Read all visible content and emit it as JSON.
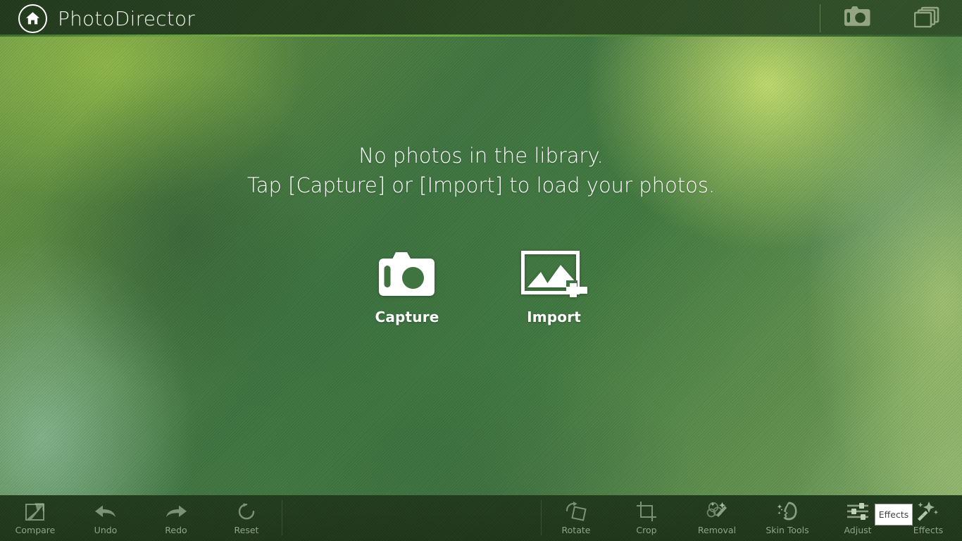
{
  "app": {
    "title": "PhotoDirector",
    "home_icon": "home-icon"
  },
  "header": {
    "buttons": [
      {
        "name": "camera-icon",
        "label": "Camera"
      },
      {
        "name": "library-icon",
        "label": "Library"
      }
    ]
  },
  "main": {
    "empty_line1": "No photos in the library.",
    "empty_line2": "Tap [Capture] or [Import] to load your photos.",
    "actions": [
      {
        "name": "capture",
        "label": "Capture",
        "icon": "camera-icon"
      },
      {
        "name": "import",
        "label": "Import",
        "icon": "image-add-icon"
      }
    ]
  },
  "toolbar": {
    "left": [
      {
        "name": "compare",
        "label": "Compare",
        "icon": "compare-icon",
        "enabled": false
      },
      {
        "name": "undo",
        "label": "Undo",
        "icon": "undo-arrow-icon",
        "enabled": false
      },
      {
        "name": "redo",
        "label": "Redo",
        "icon": "redo-arrow-icon",
        "enabled": false
      },
      {
        "name": "reset",
        "label": "Reset",
        "icon": "reset-circle-icon",
        "enabled": false
      }
    ],
    "right": [
      {
        "name": "rotate",
        "label": "Rotate",
        "icon": "rotate-icon",
        "enabled": false
      },
      {
        "name": "crop",
        "label": "Crop",
        "icon": "crop-icon",
        "enabled": false
      },
      {
        "name": "removal",
        "label": "Removal",
        "icon": "magic-removal-icon",
        "enabled": false
      },
      {
        "name": "skin-tools",
        "label": "Skin Tools",
        "icon": "face-profile-icon",
        "enabled": false
      },
      {
        "name": "adjust",
        "label": "Adjust",
        "icon": "sliders-icon",
        "enabled": false
      },
      {
        "name": "effects",
        "label": "Effects",
        "icon": "magic-wand-icon",
        "enabled": false
      }
    ]
  },
  "tooltip": {
    "text": "Effects"
  },
  "colors": {
    "header_bg": "#26411f",
    "toolbar_bg": "#213a1c",
    "accent_green": "#79b546",
    "label_dim": "#8fa586",
    "text_white": "#ffffff",
    "tooltip_bg": "#ffffff",
    "tooltip_border": "#9a9a9a",
    "tooltip_text": "#444444"
  }
}
